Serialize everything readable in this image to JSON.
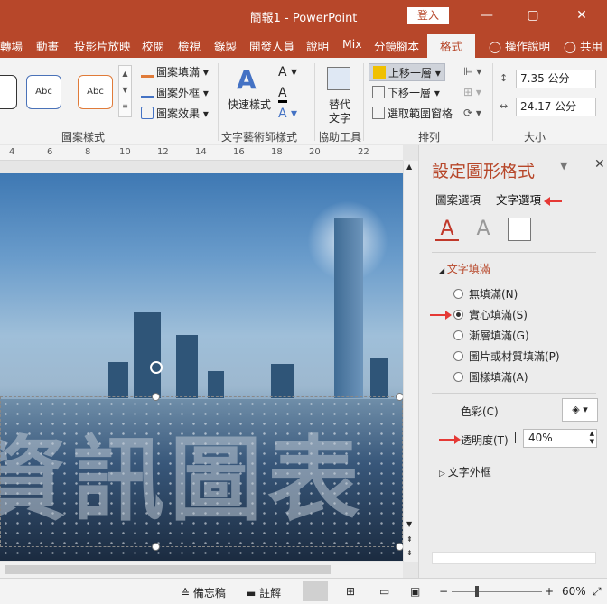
{
  "title_bar": {
    "document_title": "簡報1 - PowerPoint",
    "signin_label": "登入",
    "minimize_icon": "minimize-icon",
    "maximize_icon": "maximize-icon",
    "close_icon": "close-icon"
  },
  "tabs": {
    "items": [
      "轉場",
      "動畫",
      "投影片放映",
      "校閱",
      "檢視",
      "錄製",
      "開發人員",
      "說明",
      "Mix",
      "分鏡腳本",
      "格式"
    ],
    "active": "格式",
    "tell_me": "操作說明",
    "share": "共用"
  },
  "ribbon": {
    "shape_styles": {
      "style_sample_1": "Abc",
      "style_sample_2": "Abc",
      "fill": "圖案填滿",
      "outline": "圖案外框",
      "effects": "圖案效果",
      "group_label": "圖案樣式"
    },
    "wordart": {
      "quick_styles": "快速樣式",
      "group_label": "文字藝術師樣式"
    },
    "accessibility": {
      "alt_text_line1": "替代",
      "alt_text_line2": "文字",
      "group_label": "協助工具"
    },
    "arrange": {
      "bring_forward": "上移一層",
      "send_backward": "下移一層",
      "selection_pane": "選取範圍窗格",
      "group_label": "排列"
    },
    "size": {
      "height": "7.35 公分",
      "width": "24.17 公分",
      "group_label": "大小"
    }
  },
  "ruler": {
    "ticks": [
      "4",
      "6",
      "8",
      "10",
      "12",
      "14",
      "16",
      "18",
      "20",
      "22"
    ]
  },
  "slide": {
    "text": "資訊圖表"
  },
  "task_pane": {
    "title": "設定圖形格式",
    "tab_shape": "圖案選項",
    "tab_text": "文字選項",
    "section_text_fill": "文字填滿",
    "fill_options": [
      {
        "label": "無填滿(N)",
        "selected": false
      },
      {
        "label": "實心填滿(S)",
        "selected": true
      },
      {
        "label": "漸層填滿(G)",
        "selected": false
      },
      {
        "label": "圖片或材質填滿(P)",
        "selected": false
      },
      {
        "label": "圖樣填滿(A)",
        "selected": false
      }
    ],
    "color_label": "色彩(C)",
    "transparency_label": "透明度(T)",
    "transparency_value": "40%",
    "section_text_outline": "文字外框"
  },
  "status_bar": {
    "notes": "備忘稿",
    "comments": "註解",
    "zoom": "60%"
  },
  "colors": {
    "accent": "#b7472a",
    "annotation_arrow": "#e53935"
  }
}
